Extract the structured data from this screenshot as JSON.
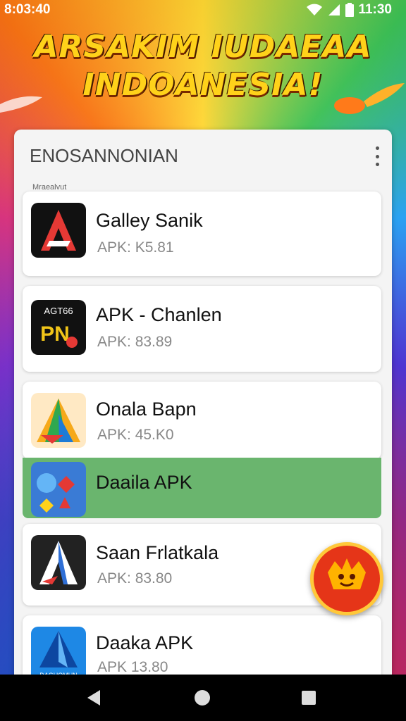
{
  "status_bar": {
    "time": "8:03:40",
    "right_text": "11:30"
  },
  "banner": {
    "line1": "ARSAKIM IUDAEAA",
    "line2": "INDOANESIA!"
  },
  "panel": {
    "title": "ENOSANNONIAN",
    "subtitle": "Mraealvut"
  },
  "apps": [
    {
      "name": "Galley Sanik",
      "apk": "APK: K5.81",
      "icon": "red-a-logo-icon"
    },
    {
      "name": "APK - Chanlen",
      "apk": "APK: 83.89",
      "icon": "gold-badge-logo-icon"
    },
    {
      "name": "Onala Bapn",
      "apk": "APK: 45.K0",
      "icon": "colorful-triangle-logo-icon"
    },
    {
      "name": "Daaila APK",
      "apk": "",
      "icon": "multi-symbol-logo-icon"
    },
    {
      "name": "Saan Frlatkala",
      "apk": "APK: 83.80",
      "icon": "blue-a-logo-icon"
    },
    {
      "name": "Daaka APK",
      "apk": "APK 13.80",
      "icon": "blue-arrow-logo-icon"
    }
  ],
  "icon_texts": {
    "app2_top": "AGT66",
    "app2_mid": "PN",
    "app6_bottom": "DAGUOMUN"
  },
  "fab": {
    "icon": "mascot-icon"
  },
  "colors": {
    "highlight": "#6ab56e",
    "fab": "#e53518",
    "banner_text": "#ffd21a"
  }
}
